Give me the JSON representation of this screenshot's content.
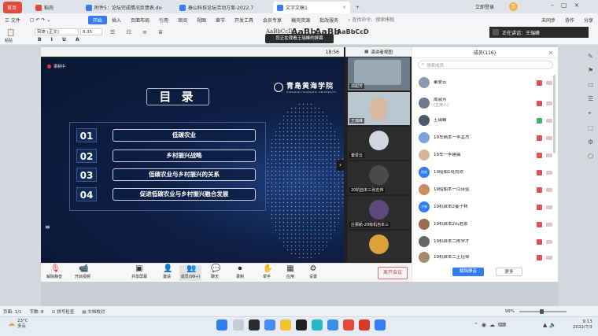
{
  "browser_tabs": [
    {
      "label": "首页",
      "kind": "home"
    },
    {
      "label": "稻壳",
      "kind": "normal",
      "color": "#e5473a"
    },
    {
      "label": "附件5：论坛完成情况反馈表.doc",
      "kind": "normal",
      "color": "#3a7af2"
    },
    {
      "label": "泰山科技论坛活动方案-2022.7",
      "kind": "normal",
      "color": "#3a7af2"
    },
    {
      "label": "文字文稿1",
      "kind": "active",
      "color": "#3a7af2"
    }
  ],
  "titlebar_actions": {
    "login": "立即登录",
    "avatar_letter": "方",
    "add_tab": "+"
  },
  "ribbon": {
    "file": "三 文件",
    "menus": [
      "开始",
      "插入",
      "页面布局",
      "引用",
      "审阅",
      "视图",
      "章节",
      "开发工具",
      "会员专享",
      "稿壳资源",
      "批改服务"
    ],
    "search": "查找命令、搜索模板",
    "right_actions": [
      "未同步",
      "协作",
      "分享"
    ],
    "paste": "粘贴",
    "font": "宋体 (正文)",
    "font_size": "8.35",
    "style_samples": [
      "AaBbCcDd",
      "AaBb",
      "AaBb",
      "AaBbCcD"
    ]
  },
  "speaking_banner": "正在讲话：王瑞峰",
  "viewing_banner": "您正在观看王瑞峰的屏幕",
  "meeting": {
    "clock": "18:56",
    "recording": "录制中",
    "slide": {
      "title": "目 录",
      "school_name": "青島黄海学院",
      "school_en": "QINGDAO HUANGHAI UNIVERSITY",
      "items": [
        {
          "num": "01",
          "text": "低碳农业"
        },
        {
          "num": "02",
          "text": "乡村振兴战略"
        },
        {
          "num": "03",
          "text": "低碳农业与乡村振兴的关系"
        },
        {
          "num": "04",
          "text": "促进低碳农业与乡村振兴融合发展"
        }
      ]
    },
    "video_panel": {
      "header": "演讲者视图",
      "tiles": [
        {
          "name": "郑超芳"
        },
        {
          "name": "王瑞峰"
        },
        {
          "name": "秦爱云"
        },
        {
          "name": "20机自本三张志伟"
        },
        {
          "name": "庄振航-20级机自本三"
        },
        {
          "name": ""
        }
      ]
    },
    "participants": {
      "header": "成员(116)",
      "search_placeholder": "搜索成员",
      "members": [
        {
          "name": "秦爱云",
          "sub": "",
          "avatar": "",
          "color": "#8a9bb1"
        },
        {
          "name": "周淑芳",
          "sub": "(主持人)",
          "avatar": "",
          "color": "#6c7b8c"
        },
        {
          "name": "王瑞峰",
          "sub": "",
          "avatar": "",
          "color": "#4a5a6a"
        },
        {
          "name": "19车辆本一李孟杰",
          "sub": "",
          "avatar": "",
          "color": "#7aa2d6"
        },
        {
          "name": "19车一李建晨",
          "sub": "",
          "avatar": "",
          "color": "#d6b79a"
        },
        {
          "name": "19船舶1班尚欢",
          "sub": "",
          "avatar": "尚欢",
          "color": "#2f7ef2"
        },
        {
          "name": "19船舶本一闫诗蓝",
          "sub": "",
          "avatar": "",
          "color": "#c98c63"
        },
        {
          "name": "19机自本2姜子林",
          "sub": "",
          "avatar": "子林",
          "color": "#2f7ef2"
        },
        {
          "name": "19机自本2石君豪",
          "sub": "",
          "avatar": "",
          "color": "#9b6a4f"
        },
        {
          "name": "19机自本二陈学才",
          "sub": "",
          "avatar": "",
          "color": "#666"
        },
        {
          "name": "19机自本二王钰琴",
          "sub": "",
          "avatar": "",
          "color": "#a38b6d"
        }
      ],
      "buttons": {
        "unmute_all": "解除静音",
        "more": "更多"
      }
    },
    "toolbar": [
      {
        "label": "解除静音",
        "icon": "mic-off-icon",
        "glyph": "🎙"
      },
      {
        "label": "开启视频",
        "icon": "camera-off-icon",
        "glyph": "📹"
      },
      {
        "label": "共享屏幕",
        "icon": "share-screen-icon",
        "glyph": "▣"
      },
      {
        "label": "邀请",
        "icon": "invite-icon",
        "glyph": "👤"
      },
      {
        "label": "成员(99+)",
        "icon": "members-icon",
        "glyph": "👥"
      },
      {
        "label": "聊天",
        "icon": "chat-icon",
        "glyph": "💬"
      },
      {
        "label": "录制",
        "icon": "record-icon",
        "glyph": "⏺"
      },
      {
        "label": "举手",
        "icon": "raise-hand-icon",
        "glyph": "✋"
      },
      {
        "label": "应用",
        "icon": "apps-icon",
        "glyph": "▦"
      },
      {
        "label": "设置",
        "icon": "settings-icon",
        "glyph": "⚙"
      }
    ],
    "leave": "离开会议"
  },
  "statusbar": {
    "page": "页面: 1/1",
    "words": "字数: 8",
    "spell": "拼写检查",
    "proof": "文档校对",
    "zoom": "99%"
  },
  "taskbar": {
    "temp": "23°C",
    "weather": "多云",
    "time": "9:13",
    "date": "2022/7/3"
  }
}
